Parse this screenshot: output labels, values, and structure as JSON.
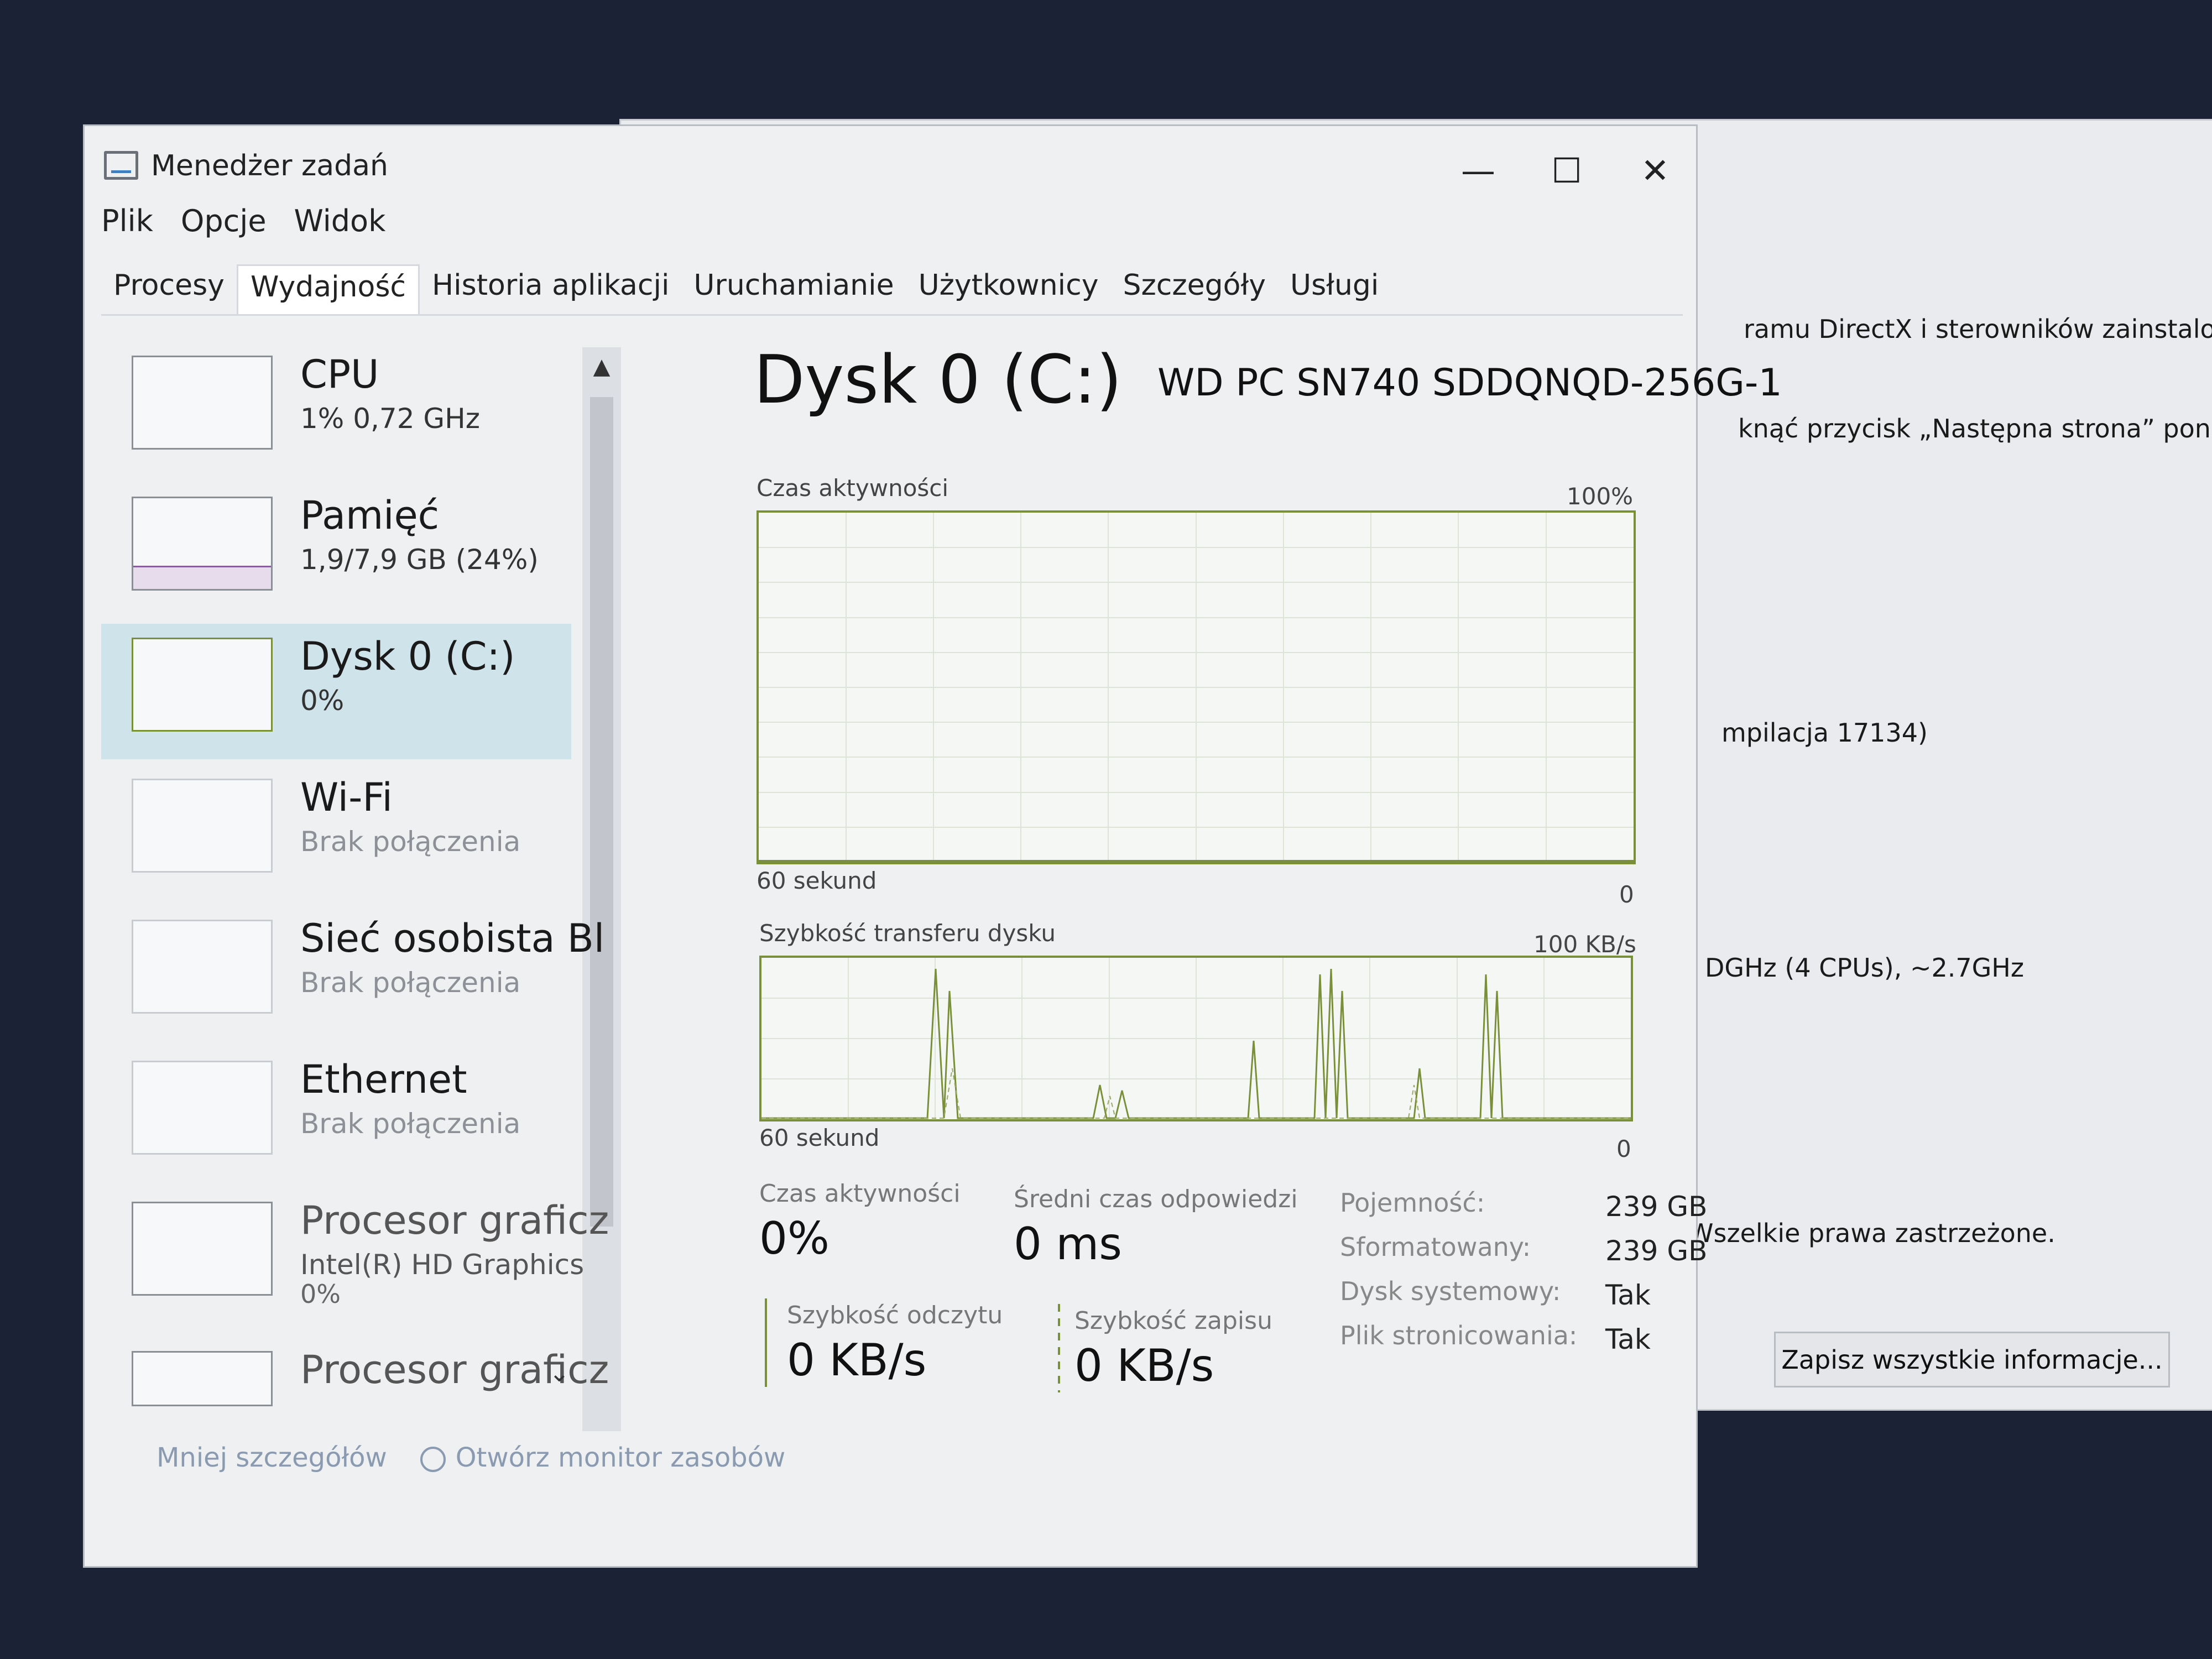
{
  "background_window": {
    "lines": [
      "ramu DirectX i sterowników zainstalowa",
      "knąć przycisk „Następna strona” poniżej,",
      "mpilacja 17134)",
      "DGHz (4 CPUs), ~2.7GHz",
      "Wszelkie prawa zastrzeżone."
    ],
    "save_button": "Zapisz wszystkie informacje..."
  },
  "window": {
    "title": "Menedżer zadań",
    "controls": {
      "minimize": "—",
      "maximize": "☐",
      "close": "✕"
    }
  },
  "menu": [
    "Plik",
    "Opcje",
    "Widok"
  ],
  "tabs": [
    "Procesy",
    "Wydajność",
    "Historia aplikacji",
    "Uruchamianie",
    "Użytkownicy",
    "Szczegóły",
    "Usługi"
  ],
  "active_tab": "Wydajność",
  "sidebar": {
    "items": [
      {
        "name": "CPU",
        "sub": "1% 0,72 GHz"
      },
      {
        "name": "Pamięć",
        "sub": "1,9/7,9 GB (24%)",
        "fill": 0.24
      },
      {
        "name": "Dysk 0 (C:)",
        "sub": "0%"
      },
      {
        "name": "Wi-Fi",
        "sub": "Brak połączenia"
      },
      {
        "name": "Sieć osobista Bl",
        "sub": "Brak połączenia"
      },
      {
        "name": "Ethernet",
        "sub": "Brak połączenia"
      },
      {
        "name": "Procesor graficz",
        "sub": "Intel(R) HD Graphics",
        "sub2": "0%"
      },
      {
        "name": "Procesor graficz"
      }
    ],
    "selected": "Dysk 0 (C:)"
  },
  "footer": {
    "fewer_details": "Mniej szczegółów",
    "open_monitor": "Otwórz monitor zasobów"
  },
  "detail": {
    "title": "Dysk 0 (C:)",
    "model": "WD PC SN740 SDDQNQD-256G-1",
    "activity_graph": {
      "label": "Czas aktywności",
      "max": "100%",
      "time": "60 sekund",
      "min": "0"
    },
    "transfer_graph": {
      "label": "Szybkość transferu dysku",
      "max": "100 KB/s",
      "time": "60 sekund",
      "min": "0"
    },
    "stats": {
      "active_time_label": "Czas aktywności",
      "active_time_value": "0%",
      "avg_response_label": "Średni czas odpowiedzi",
      "avg_response_value": "0 ms",
      "read_speed_label": "Szybkość odczytu",
      "read_speed_value": "0 KB/s",
      "write_speed_label": "Szybkość zapisu",
      "write_speed_value": "0 KB/s"
    },
    "properties": [
      {
        "label": "Pojemność:",
        "value": "239 GB"
      },
      {
        "label": "Sformatowany:",
        "value": "239 GB"
      },
      {
        "label": "Dysk systemowy:",
        "value": "Tak"
      },
      {
        "label": "Plik stronicowania:",
        "value": "Tak"
      }
    ]
  },
  "colors": {
    "disk_accent": "#7a8f3a",
    "selected_bg": "#cfe3ea",
    "memory_accent": "#8b5aa8"
  }
}
